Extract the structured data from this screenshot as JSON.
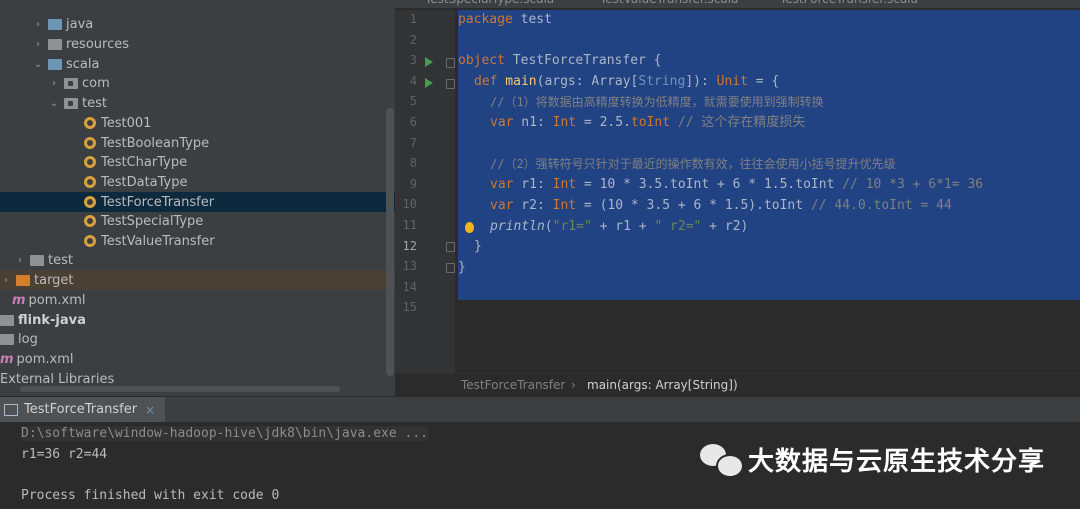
{
  "editor_tabs": [
    "TestSpecialType.scala",
    "TestValueTransfer.scala",
    "TestForceTransfer.scala"
  ],
  "tree": [
    {
      "label": "java",
      "arrow": "›",
      "icon": "blue"
    },
    {
      "label": "resources",
      "arrow": "›",
      "icon": "grey"
    },
    {
      "label": "scala",
      "arrow": "⌄",
      "icon": "blue"
    },
    {
      "label": "com",
      "arrow": "›",
      "icon": "pkg"
    },
    {
      "label": "test",
      "arrow": "⌄",
      "icon": "pkg"
    },
    {
      "label": "Test001",
      "icon": "object"
    },
    {
      "label": "TestBooleanType",
      "icon": "object"
    },
    {
      "label": "TestCharType",
      "icon": "object"
    },
    {
      "label": "TestDataType",
      "icon": "object"
    },
    {
      "label": "TestForceTransfer",
      "icon": "object",
      "selected": true
    },
    {
      "label": "TestSpecialType",
      "icon": "object"
    },
    {
      "label": "TestValueTransfer",
      "icon": "object"
    },
    {
      "label": "test",
      "arrow": "›",
      "icon": "grey"
    },
    {
      "label": "target",
      "arrow": "›",
      "icon": "orange"
    },
    {
      "label": "pom.xml",
      "icon": "maven"
    },
    {
      "label": "flink-java",
      "icon": "folder-bold"
    },
    {
      "label": "log",
      "icon": "grey"
    },
    {
      "label": "pom.xml",
      "icon": "maven"
    },
    {
      "label": "External Libraries",
      "icon": "none"
    }
  ],
  "code": {
    "line_numbers": [
      "1",
      "2",
      "3",
      "4",
      "5",
      "6",
      "7",
      "8",
      "9",
      "10",
      "11",
      "12",
      "13",
      "14",
      "15"
    ],
    "l1": {
      "kw": "package",
      "rest": " test"
    },
    "l3": {
      "kw": "object",
      "name": " TestForceTransfer {"
    },
    "l4": {
      "kw": "def",
      "fn": " main",
      "p1": "(args: Array[",
      "ty": "String",
      "p2": "]): ",
      "unit": "Unit",
      "p3": " = {"
    },
    "l5": "//（1）将数据由高精度转换为低精度，就需要使用到强制转换",
    "l6": {
      "kw": "var",
      "a": " n1: ",
      "ty": "Int",
      "b": " = 2.5.",
      "c": "toInt",
      "cm": " // 这个存在精度损失"
    },
    "l8": "//（2）强转符号只针对于最近的操作数有效，往往会使用小括号提升优先级",
    "l9": {
      "kw": "var",
      "a": " r1: ",
      "ty": "Int",
      "b": " = 10 * 3.5.toInt + 6 * 1.5.toInt",
      "cm": " // 10 *3 + 6*1= 36"
    },
    "l10": {
      "kw": "var",
      "a": " r2: ",
      "ty": "Int",
      "b": " = (10 * 3.5 + 6 * 1.5).toInt",
      "cm": " // 44.0.toInt = 44"
    },
    "l11": {
      "fn": "println",
      "a": "(",
      "s1": "\"r1=\"",
      "b": " + r1 + ",
      "s2": "\" r2=\"",
      "c": " + r2)"
    },
    "l12": "}",
    "l13": "}"
  },
  "breadcrumb": {
    "object": "TestForceTransfer",
    "separator": "›",
    "method": "main(args: Array[String])"
  },
  "run": {
    "tab_label": "TestForceTransfer",
    "close": "×",
    "cmd": "D:\\software\\window-hadoop-hive\\jdk8\\bin\\java.exe ...",
    "out1": "r1=36 r2=44",
    "out2": "Process finished with exit code 0"
  },
  "watermark": "大数据与云原生技术分享",
  "colors": {
    "selection": "#214283",
    "keyword": "#cc7832",
    "string": "#6a8759",
    "comment": "#808080",
    "run_icon": "#499c54"
  }
}
